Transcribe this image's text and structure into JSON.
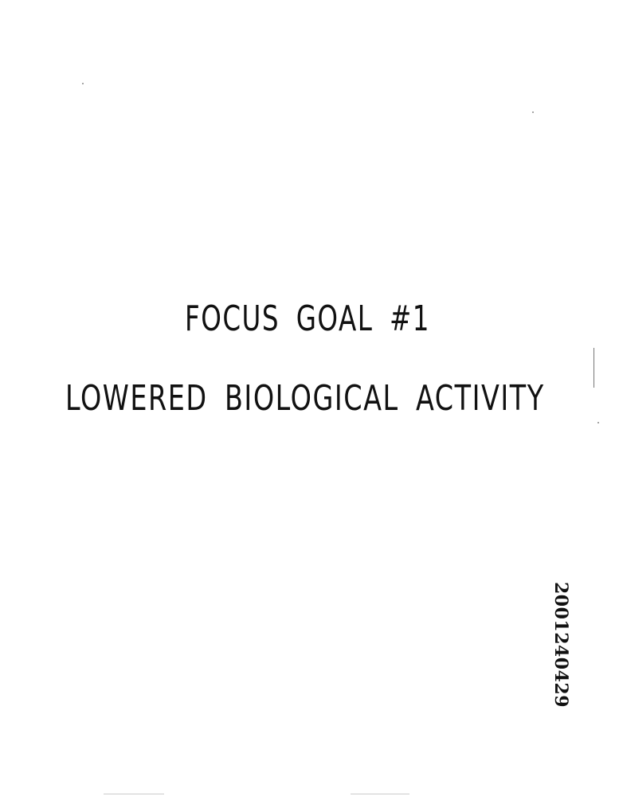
{
  "document": {
    "heading": "FOCUS GOAL #1",
    "subheading": "LOWERED BIOLOGICAL ACTIVITY",
    "bates_number": "2001240429"
  }
}
